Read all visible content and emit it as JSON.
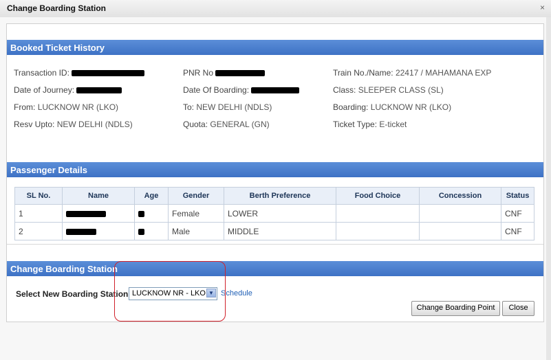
{
  "window": {
    "title": "Change Boarding Station",
    "close": "×"
  },
  "booked": {
    "heading": "Booked Ticket History",
    "transaction_id_label": "Transaction ID:",
    "pnr_label": "PNR No",
    "train_label": "Train No./Name:",
    "train_value": "22417 /  MAHAMANA EXP",
    "doj_label": "Date of Journey:",
    "dob_label": "Date Of Boarding:",
    "class_label": "Class:",
    "class_value": "SLEEPER CLASS (SL)",
    "from_label": "From:",
    "from_value": "LUCKNOW NR (LKO)",
    "to_label": "To:",
    "to_value": "NEW DELHI (NDLS)",
    "boarding_label": "Boarding:",
    "boarding_value": "LUCKNOW NR (LKO)",
    "resv_label": "Resv Upto:",
    "resv_value": "NEW DELHI (NDLS)",
    "quota_label": "Quota:",
    "quota_value": "GENERAL (GN)",
    "ticket_type_label": "Ticket Type:",
    "ticket_type_value": "E-ticket"
  },
  "passengers": {
    "heading": "Passenger Details",
    "columns": [
      "SL No.",
      "Name",
      "Age",
      "Gender",
      "Berth Preference",
      "Food Choice",
      "Concession",
      "Status"
    ],
    "rows": [
      {
        "sl": "1",
        "gender": "Female",
        "berth": "LOWER",
        "food": "",
        "concession": "",
        "status": "CNF"
      },
      {
        "sl": "2",
        "gender": "Male",
        "berth": "MIDDLE",
        "food": "",
        "concession": "",
        "status": "CNF"
      }
    ]
  },
  "change": {
    "heading": "Change Boarding Station",
    "select_label": "Select New Boarding Station :",
    "selected_station": "LUCKNOW NR - LKO",
    "schedule_link": "Schedule",
    "change_button": "Change Boarding Point",
    "close_button": "Close"
  }
}
